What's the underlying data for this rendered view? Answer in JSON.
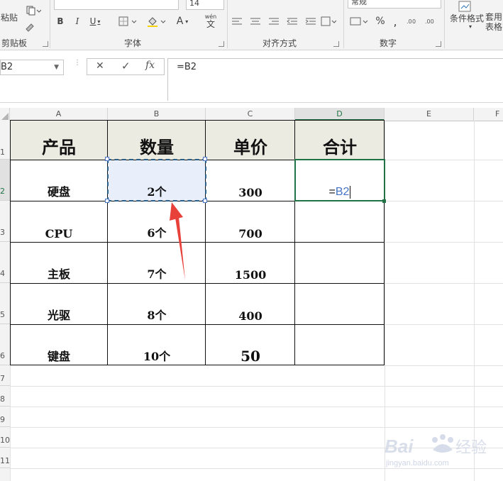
{
  "ribbon": {
    "paste_label": "粘贴",
    "font_size": "14",
    "bold": "B",
    "italic": "I",
    "underline": "U",
    "font_color_letter": "A",
    "wen_label": "wén",
    "wen_char": "文",
    "number_format": "常规",
    "percent": "%",
    "comma": ",",
    "cond_format_label": "条件格式",
    "table_format_label": "套用\n表格",
    "groups": {
      "clipboard": "剪贴板",
      "font": "字体",
      "alignment": "对齐方式",
      "number": "数字"
    }
  },
  "formula_bar": {
    "name_box": "B2",
    "cancel": "✕",
    "enter": "✓",
    "fx": "fx",
    "formula": "=B2"
  },
  "columns": [
    "A",
    "B",
    "C",
    "D",
    "E",
    "F"
  ],
  "rows": [
    "1",
    "2",
    "3",
    "4",
    "5",
    "6",
    "7",
    "8",
    "9",
    "10",
    "11"
  ],
  "table": {
    "headers": [
      "产品",
      "数量",
      "单价",
      "合计"
    ],
    "rows": [
      {
        "product": "硬盘",
        "qty": "2个",
        "price": "300"
      },
      {
        "product": "CPU",
        "qty": "6个",
        "price": "700"
      },
      {
        "product": "主板",
        "qty": "7个",
        "price": "1500"
      },
      {
        "product": "光驱",
        "qty": "8个",
        "price": "400"
      },
      {
        "product": "键盘",
        "qty": "10个",
        "price": "50"
      }
    ]
  },
  "editing_cell": {
    "prefix": "=",
    "ref": "B2"
  },
  "colors": {
    "active_border": "#217346",
    "selection_dash": "#2a5f8a",
    "selection_fill": "#e8effb",
    "ref_text": "#4472c4",
    "arrow": "#e8413a",
    "header_fill": "#ecebe2"
  },
  "watermark": {
    "brand": "Baidu 经验",
    "url": "jingyan.baidu.com"
  }
}
